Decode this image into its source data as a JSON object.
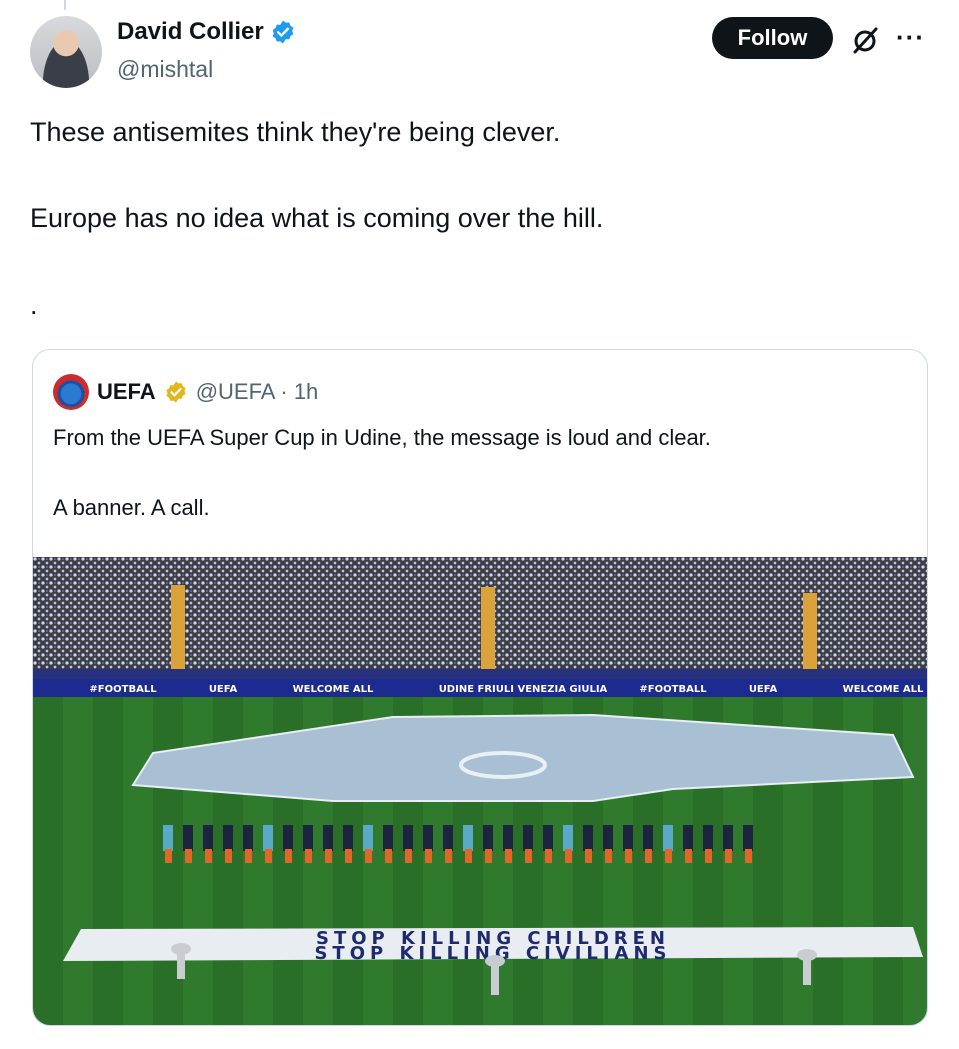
{
  "author": {
    "name": "David Collier",
    "handle": "@mishtal"
  },
  "actions": {
    "follow_label": "Follow",
    "more_label": "···"
  },
  "tweet": {
    "line1": "These antisemites think they're being clever.",
    "line2": "Europe has no idea what is coming over the hill.",
    "line3": "."
  },
  "quoted": {
    "name": "UEFA",
    "handle_time": "@UEFA · 1h",
    "line1": "From the UEFA Super Cup in Udine, the message is loud and clear.",
    "line2": "A banner. A call.",
    "image": {
      "ad_boards": [
        "#FOOTBALL",
        "UEFA",
        "WELCOME ALL",
        "UDINE FRIULI VENEZIA GIULIA",
        "#FOOTBALL",
        "UEFA",
        "WELCOME ALL"
      ],
      "banner_line1": "STOP KILLING CHILDREN",
      "banner_line2": "STOP KILLING CIVILIANS"
    }
  },
  "colors": {
    "verified_blue": "#1d9bf0",
    "verified_gold": "#e2b719",
    "pitch_green": "#2f7a2c",
    "board_blue": "#1d2a8f"
  },
  "icons": [
    "verified-icon",
    "grok-icon",
    "more-icon",
    "gold-verified-icon"
  ]
}
